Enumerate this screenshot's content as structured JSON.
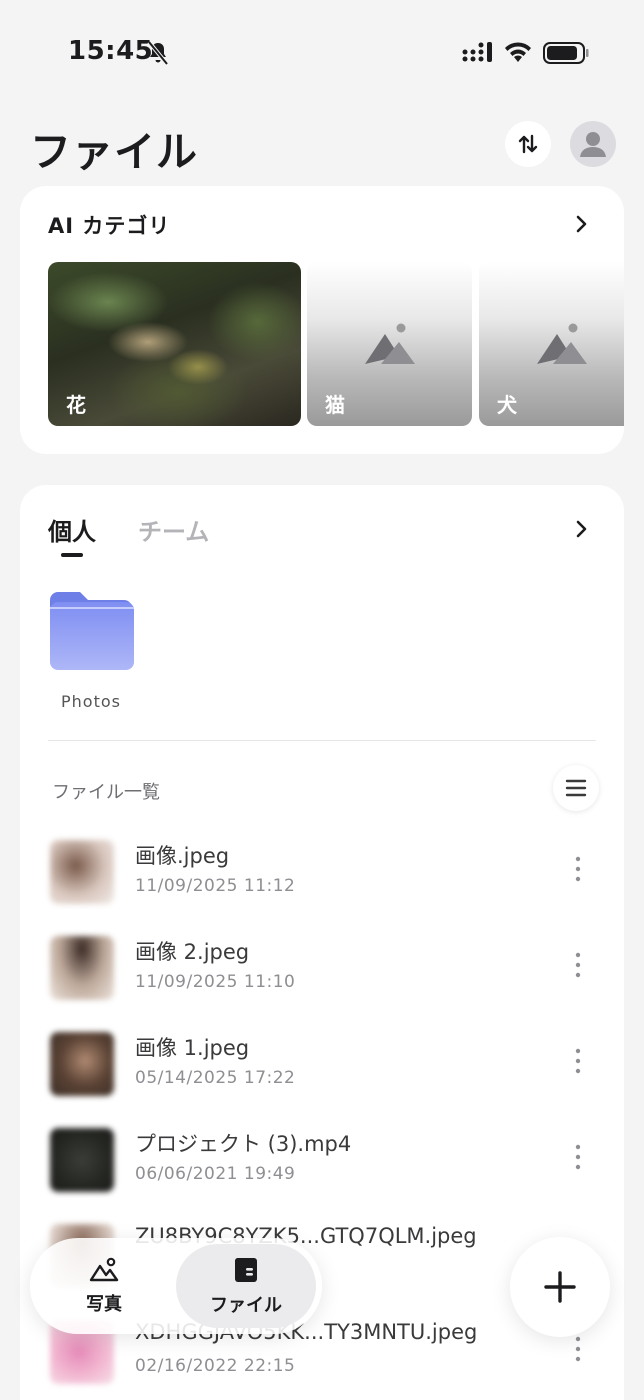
{
  "status_bar": {
    "time": "15:45"
  },
  "header": {
    "title": "ファイル"
  },
  "ai_category": {
    "title": "AI カテゴリ",
    "tiles": [
      {
        "label": "花"
      },
      {
        "label": "猫"
      },
      {
        "label": "犬"
      }
    ]
  },
  "tabs": [
    {
      "label": "個人",
      "active": true
    },
    {
      "label": "チーム",
      "active": false
    }
  ],
  "folders": [
    {
      "label": "Photos"
    }
  ],
  "file_list": {
    "heading": "ファイル一覧",
    "items": [
      {
        "name": "画像.jpeg",
        "date": "11/09/2025 11:12"
      },
      {
        "name": "画像 2.jpeg",
        "date": "11/09/2025 11:10"
      },
      {
        "name": "画像 1.jpeg",
        "date": "05/14/2025 17:22"
      },
      {
        "name": "プロジェクト (3).mp4",
        "date": "06/06/2021 19:49"
      },
      {
        "name": "ZU8BY9C8YZK5...GTQ7QLM.jpeg",
        "date": ""
      },
      {
        "name": "XDHGGJAVO5KK...TY3MNTU.jpeg",
        "date": "02/16/2022 22:15"
      }
    ]
  },
  "bottom_nav": {
    "items": [
      {
        "label": "写真",
        "icon": "photo-icon"
      },
      {
        "label": "ファイル",
        "icon": "file-icon",
        "active": true
      }
    ]
  },
  "fab": {
    "icon": "plus-icon"
  }
}
